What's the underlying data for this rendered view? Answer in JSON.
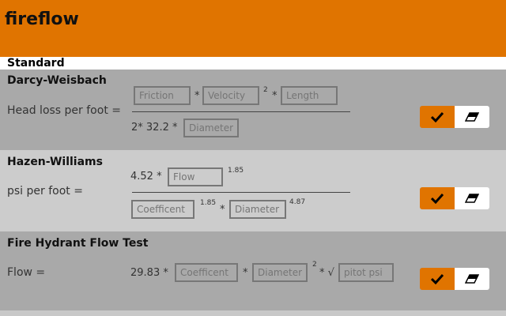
{
  "app": {
    "title": "fireflow"
  },
  "mode": {
    "label": "Standard"
  },
  "darcy": {
    "title": "Darcy-Weisbach",
    "result_label": "Head loss per foot =",
    "friction_placeholder": "Friction",
    "velocity_placeholder": "Velocity",
    "length_placeholder": "Length",
    "diameter_placeholder": "Diameter",
    "times_1": "*",
    "exp_2": "2",
    "times_2": "*",
    "denominator_prefix": "2* 32.2 *"
  },
  "hazen": {
    "title": "Hazen-Williams",
    "result_label": "psi per foot =",
    "numerator_prefix": "4.52 *",
    "flow_placeholder": "Flow",
    "exp_flow": "1.85",
    "coefficient_placeholder": "Coefficent",
    "exp_coefficient": "1.85",
    "times": "*",
    "diameter_placeholder": "Diameter",
    "exp_diameter": "4.87"
  },
  "hydrant": {
    "title": "Fire Hydrant Flow Test",
    "result_label": "Flow =",
    "prefix": "29.83 *",
    "coefficient_placeholder": "Coefficent",
    "times_1": "*",
    "diameter_placeholder": "Diameter",
    "exp_diameter": "2",
    "times_sqrt": "* √",
    "pitot_placeholder": "pitot psi"
  },
  "icons": {
    "calculate": "checkmark-icon",
    "clear": "eraser-icon"
  },
  "colors": {
    "accent": "#e07400",
    "section_dark": "#a9a9a9",
    "section_light": "#cccccc"
  }
}
